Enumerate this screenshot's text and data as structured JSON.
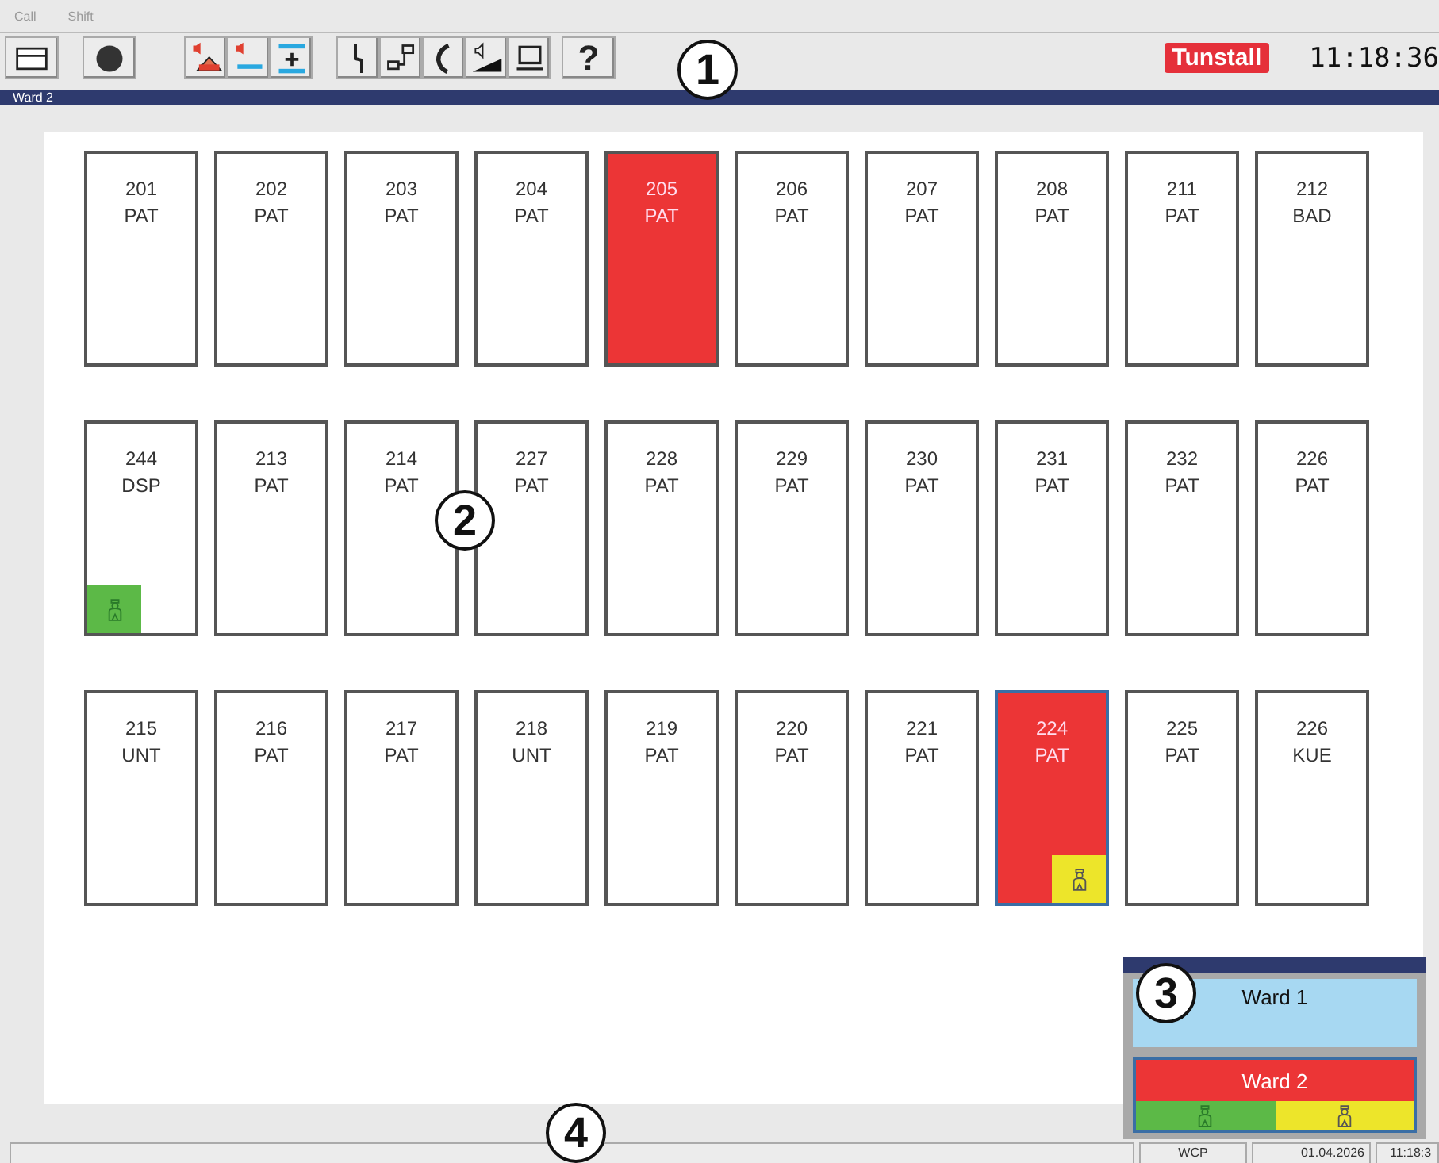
{
  "menu": [
    "Call",
    "Shift"
  ],
  "toolbar": [
    [
      {
        "kind": "window"
      }
    ],
    [
      {
        "kind": "record"
      }
    ],
    [
      {
        "kind": "alarm-volume"
      },
      {
        "kind": "volume-down"
      },
      {
        "kind": "volume-up"
      }
    ],
    [
      {
        "kind": "line"
      },
      {
        "kind": "network"
      },
      {
        "kind": "phone"
      },
      {
        "kind": "speaker"
      },
      {
        "kind": "monitor"
      }
    ],
    [
      {
        "kind": "help",
        "label": "?"
      }
    ]
  ],
  "logo": "Tunstall",
  "clock": "11:18:36",
  "ward_title": "Ward 2",
  "rooms": [
    [
      {
        "number": "201",
        "type": "PAT",
        "alarm": false,
        "selected": false
      },
      {
        "number": "202",
        "type": "PAT",
        "alarm": false,
        "selected": false
      },
      {
        "number": "203",
        "type": "PAT",
        "alarm": false,
        "selected": false
      },
      {
        "number": "204",
        "type": "PAT",
        "alarm": false,
        "selected": false
      },
      {
        "number": "205",
        "type": "PAT",
        "alarm": true,
        "selected": false
      },
      {
        "number": "206",
        "type": "PAT",
        "alarm": false,
        "selected": false
      },
      {
        "number": "207",
        "type": "PAT",
        "alarm": false,
        "selected": false
      },
      {
        "number": "208",
        "type": "PAT",
        "alarm": false,
        "selected": false
      },
      {
        "number": "211",
        "type": "PAT",
        "alarm": false,
        "selected": false
      },
      {
        "number": "212",
        "type": "BAD",
        "alarm": false,
        "selected": false
      }
    ],
    [
      {
        "number": "244",
        "type": "DSP",
        "alarm": false,
        "selected": false,
        "presence": {
          "color": "#5cb947"
        }
      },
      {
        "number": "213",
        "type": "PAT",
        "alarm": false,
        "selected": false
      },
      {
        "number": "214",
        "type": "PAT",
        "alarm": false,
        "selected": false
      },
      {
        "number": "227",
        "type": "PAT",
        "alarm": false,
        "selected": false
      },
      {
        "number": "228",
        "type": "PAT",
        "alarm": false,
        "selected": false
      },
      {
        "number": "229",
        "type": "PAT",
        "alarm": false,
        "selected": false
      },
      {
        "number": "230",
        "type": "PAT",
        "alarm": false,
        "selected": false
      },
      {
        "number": "231",
        "type": "PAT",
        "alarm": false,
        "selected": false
      },
      {
        "number": "232",
        "type": "PAT",
        "alarm": false,
        "selected": false
      },
      {
        "number": "226",
        "type": "PAT",
        "alarm": false,
        "selected": false
      }
    ],
    [
      {
        "number": "215",
        "type": "UNT",
        "alarm": false,
        "selected": false
      },
      {
        "number": "216",
        "type": "PAT",
        "alarm": false,
        "selected": false
      },
      {
        "number": "217",
        "type": "PAT",
        "alarm": false,
        "selected": false
      },
      {
        "number": "218",
        "type": "UNT",
        "alarm": false,
        "selected": false
      },
      {
        "number": "219",
        "type": "PAT",
        "alarm": false,
        "selected": false
      },
      {
        "number": "220",
        "type": "PAT",
        "alarm": false,
        "selected": false
      },
      {
        "number": "221",
        "type": "PAT",
        "alarm": false,
        "selected": false
      },
      {
        "number": "224",
        "type": "PAT",
        "alarm": true,
        "selected": true,
        "presence": {
          "color": "#ede52a"
        }
      },
      {
        "number": "225",
        "type": "PAT",
        "alarm": false,
        "selected": false
      },
      {
        "number": "226",
        "type": "KUE",
        "alarm": false,
        "selected": false
      }
    ]
  ],
  "overview": [
    {
      "name": "Ward 1",
      "alarm": false
    },
    {
      "name": "Ward 2",
      "alarm": true,
      "presence": [
        {
          "color": "#5cb947"
        },
        {
          "color": "#ede52a"
        }
      ]
    }
  ],
  "status_bar": [
    "WCP",
    "01.04.2026",
    "11:18:3"
  ],
  "callouts": [
    "1",
    "2",
    "3",
    "4"
  ]
}
